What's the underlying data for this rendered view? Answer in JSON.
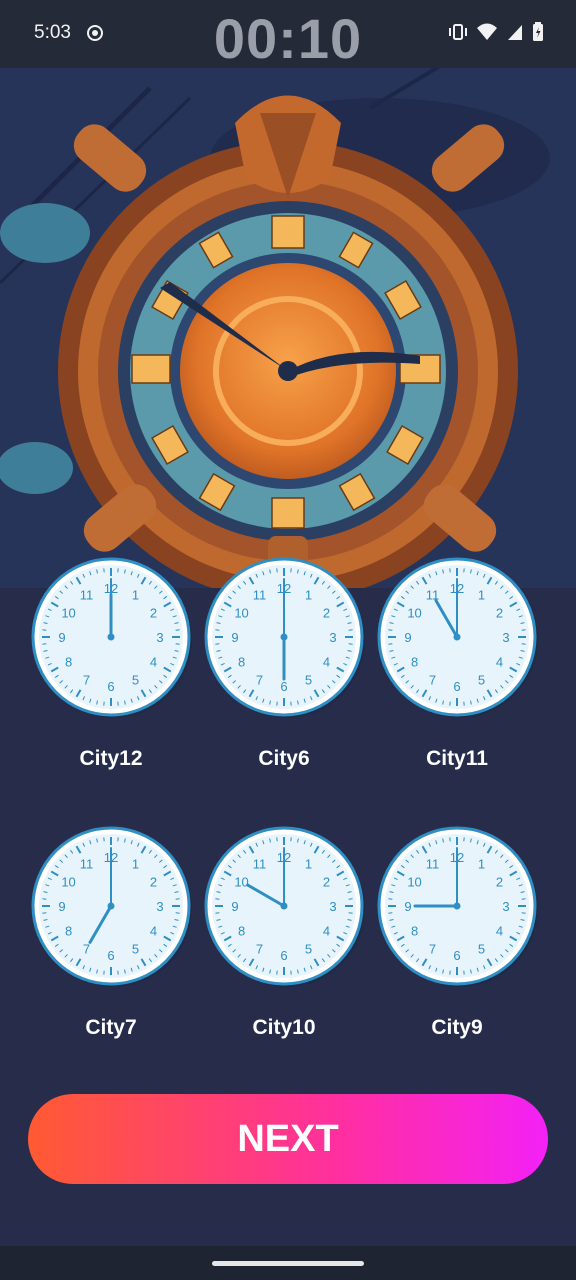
{
  "status_bar": {
    "time": "5:03",
    "timer": "00:10",
    "icons": [
      "record-icon",
      "vibrate-icon",
      "wifi-icon",
      "signal-icon",
      "battery-icon"
    ]
  },
  "hero": {
    "image": "steampunk-clock-illustration"
  },
  "clocks": [
    {
      "city": "City12",
      "hour": 12,
      "minute": 0
    },
    {
      "city": "City6",
      "hour": 6,
      "minute": 0
    },
    {
      "city": "City11",
      "hour": 11,
      "minute": 0
    },
    {
      "city": "City7",
      "hour": 7,
      "minute": 0
    },
    {
      "city": "City10",
      "hour": 10,
      "minute": 0
    },
    {
      "city": "City9",
      "hour": 9,
      "minute": 0
    }
  ],
  "next_button": {
    "label": "NEXT"
  },
  "colors": {
    "background": "#262c4a",
    "button_start": "#ff5a32",
    "button_end": "#f321f6",
    "clock_accent": "#2f8fc4"
  }
}
